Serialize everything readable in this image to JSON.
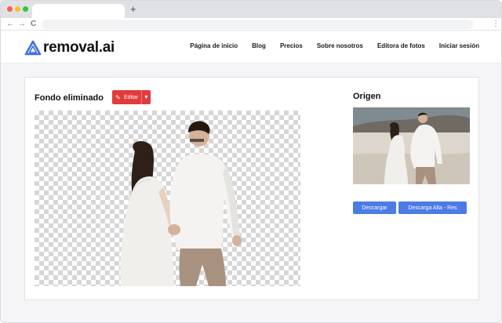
{
  "browser": {
    "new_tab_symbol": "+",
    "nav_back": "←",
    "nav_forward": "→",
    "nav_reload": "C",
    "menu_symbol": "⋮"
  },
  "header": {
    "logo_text": "removal.ai",
    "logo_icon": "triangle-a-icon",
    "brand_color": "#3d6fe0",
    "menu": [
      {
        "label": "Página de inicio"
      },
      {
        "label": "Blog"
      },
      {
        "label": "Precios"
      },
      {
        "label": "Sobre nosotros"
      },
      {
        "label": "Editora de fotos"
      },
      {
        "label": "Iniciar sesión"
      }
    ]
  },
  "result": {
    "title": "Fondo eliminado",
    "edit_label": "Editar",
    "edit_icon": "pencil-icon",
    "edit_color": "#e23b3b"
  },
  "origin": {
    "title": "Origen"
  },
  "actions": {
    "download_label": "Descargar",
    "hires_label": "Descarga Alta - Res",
    "button_color": "#4c7be6"
  }
}
